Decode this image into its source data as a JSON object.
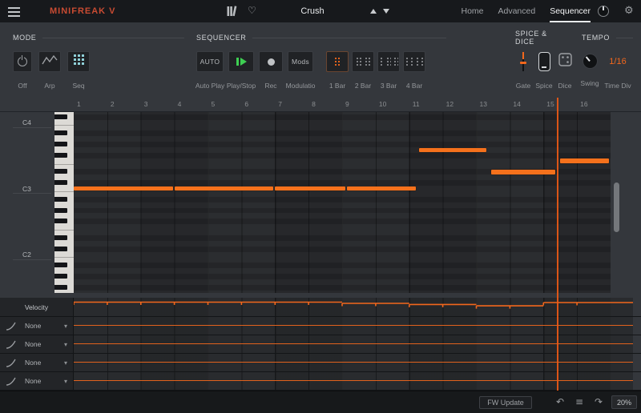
{
  "colors": {
    "accent": "#f2671c",
    "title_red": "#c94b32",
    "play_green": "#3ecf52"
  },
  "titlebar": {
    "title": "MINIFREAK V",
    "preset_name": "Crush",
    "nav": [
      {
        "label": "Home",
        "active": false
      },
      {
        "label": "Advanced",
        "active": false
      },
      {
        "label": "Sequencer",
        "active": true
      }
    ]
  },
  "panels": {
    "mode": {
      "title": "MODE",
      "buttons": [
        {
          "label": "Off",
          "icon": "power-icon",
          "active": false
        },
        {
          "label": "Arp",
          "icon": "arp-icon",
          "active": false
        },
        {
          "label": "Seq",
          "icon": "seq-grid-icon",
          "active": true
        }
      ]
    },
    "sequencer": {
      "title": "SEQUENCER",
      "auto_button": "AUTO",
      "mods_button": "Mods",
      "transport_labels": [
        "Auto Play",
        "Play/Stop",
        "Rec",
        "Modulatio"
      ],
      "bar_buttons": [
        {
          "label": "1 Bar",
          "glyphs": 1,
          "active": true
        },
        {
          "label": "2 Bar",
          "glyphs": 2,
          "active": false
        },
        {
          "label": "3 Bar",
          "glyphs": 3,
          "active": false
        },
        {
          "label": "4 Bar",
          "glyphs": 4,
          "active": false
        }
      ]
    },
    "spice_dice": {
      "title": "SPICE & DICE",
      "controls": [
        {
          "label": "Gate"
        },
        {
          "label": "Spice"
        },
        {
          "label": "Dice"
        }
      ]
    },
    "tempo": {
      "title": "TEMPO",
      "swing_label": "Swing",
      "time_div_value": "1/16",
      "time_div_label": "Time Div"
    }
  },
  "piano_roll": {
    "ruler": [
      "1",
      "2",
      "3",
      "4",
      "5",
      "6",
      "7",
      "8",
      "9",
      "10",
      "11",
      "12",
      "13",
      "14",
      "15",
      "16"
    ],
    "octave_labels": [
      {
        "pitch": "C4"
      },
      {
        "pitch": "C3"
      },
      {
        "pitch": "C2"
      }
    ],
    "playhead_step": 15.4,
    "notes": [
      {
        "pitch": "C3",
        "start": 1,
        "end": 4
      },
      {
        "pitch": "C3",
        "start": 4,
        "end": 7
      },
      {
        "pitch": "C3",
        "start": 7,
        "end": 9.15
      },
      {
        "pitch": "C3",
        "start": 9.15,
        "end": 11.25
      },
      {
        "pitch": "G3",
        "start": 11.3,
        "end": 13.35
      },
      {
        "pitch": "D#3",
        "start": 13.45,
        "end": 15.4
      },
      {
        "pitch": "F3",
        "start": 15.5,
        "end": 17
      }
    ]
  },
  "lanes": {
    "velocity_label": "Velocity",
    "velocity_values": [
      0.77,
      0.77,
      0.77,
      0.77,
      0.77,
      0.77,
      0.77,
      0.77,
      0.71,
      0.71,
      0.65,
      0.65,
      0.58,
      0.58,
      0.75,
      0.75
    ],
    "mod_lanes": [
      {
        "source": "None",
        "value": 0.55
      },
      {
        "source": "None",
        "value": 0.55
      },
      {
        "source": "None",
        "value": 0.55
      },
      {
        "source": "None",
        "value": 0.55
      }
    ]
  },
  "footer": {
    "fw_update_label": "FW Update",
    "cpu_value": "20%"
  }
}
